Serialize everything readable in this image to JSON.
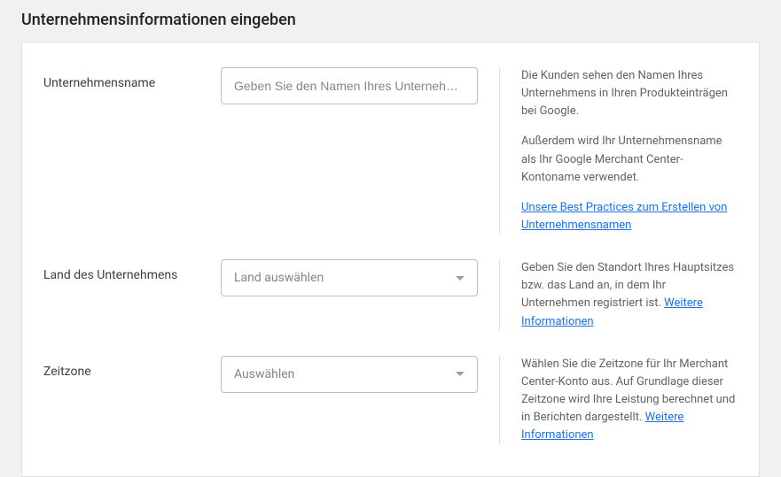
{
  "page": {
    "title": "Unternehmensinformationen eingeben"
  },
  "form": {
    "businessName": {
      "label": "Unternehmensname",
      "placeholder": "Geben Sie den Namen Ihres Unternehmens ein",
      "help1": "Die Kunden sehen den Namen Ihres Unternehmens in Ihren Produkteinträgen bei Google.",
      "help2": "Außerdem wird Ihr Unternehmensname als Ihr Google Merchant Center-Kontoname verwendet.",
      "helpLink": "Unsere Best Practices zum Erstellen von Unternehmensnamen"
    },
    "country": {
      "label": "Land des Unternehmens",
      "placeholder": "Land auswählen",
      "help": "Geben Sie den Standort Ihres Hauptsitzes bzw. das Land an, in dem Ihr Unternehmen registriert ist. ",
      "helpLink": "Weitere Informationen"
    },
    "timezone": {
      "label": "Zeitzone",
      "placeholder": "Auswählen",
      "help": "Wählen Sie die Zeitzone für Ihr Merchant Center-Konto aus. Auf Grundlage dieser Zeitzone wird Ihre Leistung berechnet und in Berichten dargestellt. ",
      "helpLink": "Weitere Informationen"
    }
  }
}
